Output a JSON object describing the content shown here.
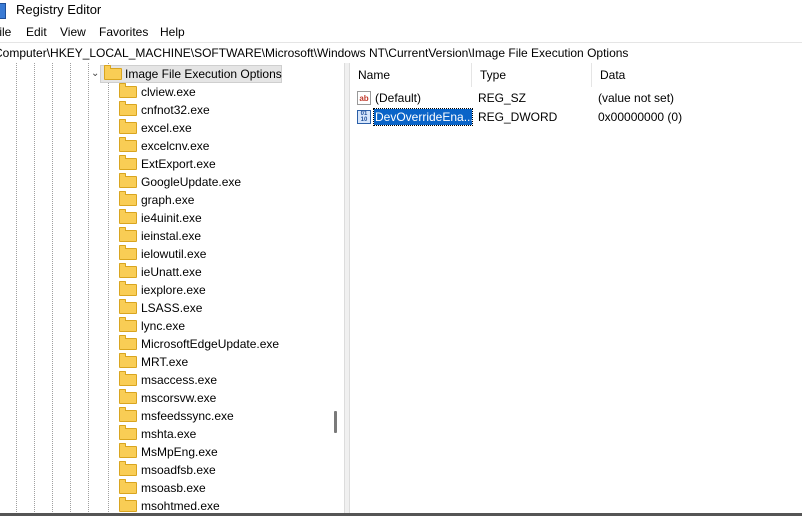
{
  "window": {
    "title": "Registry Editor"
  },
  "menu": [
    "File",
    "Edit",
    "View",
    "Favorites",
    "Help"
  ],
  "address": "Computer\\HKEY_LOCAL_MACHINE\\SOFTWARE\\Microsoft\\Windows NT\\CurrentVersion\\Image File Execution Options",
  "tree": {
    "parent": {
      "label": "Image File Execution Options",
      "expanded": true,
      "selected": true
    },
    "children": [
      "clview.exe",
      "cnfnot32.exe",
      "excel.exe",
      "excelcnv.exe",
      "ExtExport.exe",
      "GoogleUpdate.exe",
      "graph.exe",
      "ie4uinit.exe",
      "ieinstal.exe",
      "ielowutil.exe",
      "ieUnatt.exe",
      "iexplore.exe",
      "LSASS.exe",
      "lync.exe",
      "MicrosoftEdgeUpdate.exe",
      "MRT.exe",
      "msaccess.exe",
      "mscorsvw.exe",
      "msfeedssync.exe",
      "mshta.exe",
      "MsMpEng.exe",
      "msoadfsb.exe",
      "msoasb.exe",
      "msohtmed.exe"
    ]
  },
  "values": {
    "columns": {
      "name": "Name",
      "type": "Type",
      "data": "Data"
    },
    "rows": [
      {
        "name": "(Default)",
        "type": "REG_SZ",
        "data": "(value not set)",
        "icon": "string-value-icon"
      },
      {
        "name": "DevOverrideEna...",
        "type": "REG_DWORD",
        "data": "0x00000000 (0)",
        "icon": "dword-value-icon",
        "selected": true
      }
    ]
  },
  "colors": {
    "selection": "#0a64c8",
    "folder": "#f9cd55"
  }
}
